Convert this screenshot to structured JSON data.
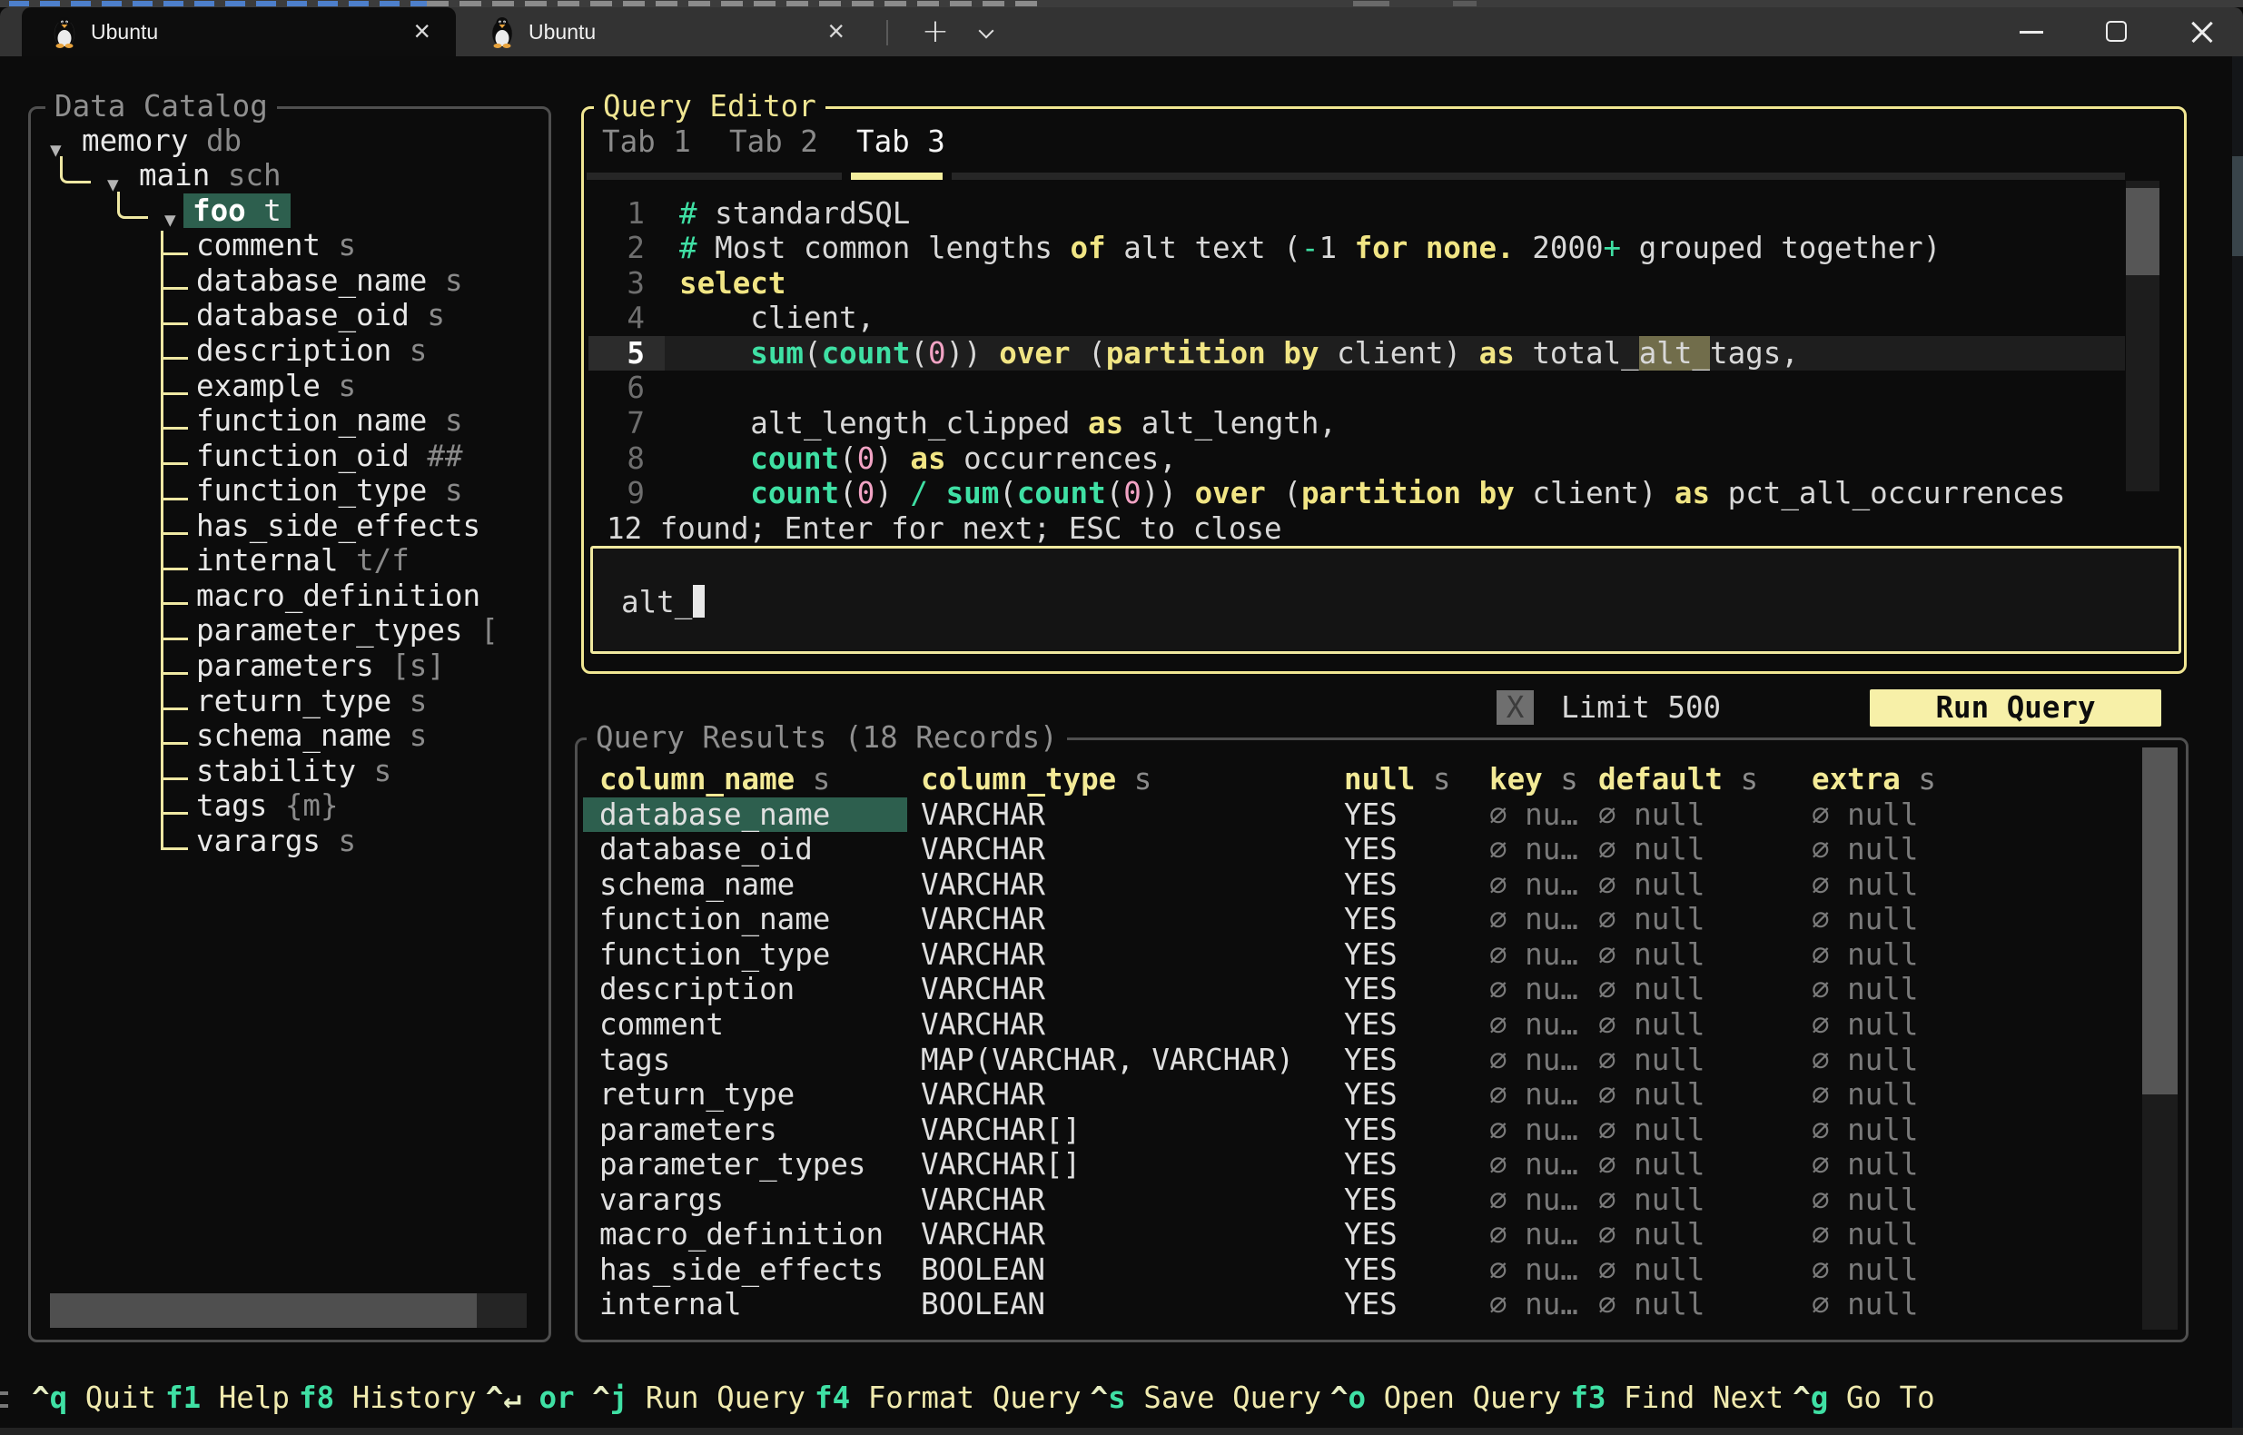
{
  "window": {
    "tabs": [
      {
        "label": "Ubuntu"
      },
      {
        "label": "Ubuntu"
      }
    ],
    "new_tab": "+",
    "close_glyph": "×"
  },
  "catalog": {
    "title": "Data Catalog",
    "items": [
      {
        "name": "memory",
        "type": "db",
        "level": 0,
        "arrow": true
      },
      {
        "name": "main",
        "type": "sch",
        "level": 1,
        "arrow": true
      },
      {
        "name": "foo",
        "type": "t",
        "level": 2,
        "arrow": true,
        "selected": true
      },
      {
        "name": "comment",
        "type": "s",
        "level": 3
      },
      {
        "name": "database_name",
        "type": "s",
        "level": 3
      },
      {
        "name": "database_oid",
        "type": "s",
        "level": 3
      },
      {
        "name": "description",
        "type": "s",
        "level": 3
      },
      {
        "name": "example",
        "type": "s",
        "level": 3
      },
      {
        "name": "function_name",
        "type": "s",
        "level": 3
      },
      {
        "name": "function_oid",
        "type": "##",
        "level": 3
      },
      {
        "name": "function_type",
        "type": "s",
        "level": 3
      },
      {
        "name": "has_side_effects",
        "type": "",
        "level": 3
      },
      {
        "name": "internal",
        "type": "t/f",
        "level": 3
      },
      {
        "name": "macro_definition",
        "type": "",
        "level": 3
      },
      {
        "name": "parameter_types",
        "type": "[",
        "level": 3
      },
      {
        "name": "parameters",
        "type": "[s]",
        "level": 3
      },
      {
        "name": "return_type",
        "type": "s",
        "level": 3
      },
      {
        "name": "schema_name",
        "type": "s",
        "level": 3
      },
      {
        "name": "stability",
        "type": "s",
        "level": 3
      },
      {
        "name": "tags",
        "type": "{m}",
        "level": 3
      },
      {
        "name": "varargs",
        "type": "s",
        "level": 3
      }
    ]
  },
  "editor": {
    "title": "Query Editor",
    "tabs": [
      "Tab 1",
      "Tab 2",
      "Tab 3"
    ],
    "active_tab": 2,
    "lines": [
      {
        "n": "1",
        "segs": [
          [
            "#",
            "o"
          ],
          [
            " standardSQL",
            "p"
          ]
        ]
      },
      {
        "n": "2",
        "segs": [
          [
            "#",
            "o"
          ],
          [
            " Most common lengths ",
            "p"
          ],
          [
            "of",
            "k"
          ],
          [
            " alt text (",
            "p"
          ],
          [
            "-",
            "o"
          ],
          [
            "1 ",
            "p"
          ],
          [
            "for none.",
            "k"
          ],
          [
            " 2000",
            "p"
          ],
          [
            "+",
            "o"
          ],
          [
            " grouped together)",
            "p"
          ]
        ]
      },
      {
        "n": "3",
        "segs": [
          [
            "select",
            "k"
          ]
        ]
      },
      {
        "n": "4",
        "segs": [
          [
            "    client,",
            "p"
          ]
        ]
      },
      {
        "n": "5",
        "current": true,
        "segs": [
          [
            "    ",
            "p"
          ],
          [
            "sum",
            "f"
          ],
          [
            "(",
            "p"
          ],
          [
            "count",
            "f"
          ],
          [
            "(",
            "p"
          ],
          [
            "0",
            "n"
          ],
          [
            ")) ",
            "p"
          ],
          [
            "over",
            "k"
          ],
          [
            " (",
            "p"
          ],
          [
            "partition",
            "k"
          ],
          [
            " ",
            "p"
          ],
          [
            "by",
            "k"
          ],
          [
            " client) ",
            "p"
          ],
          [
            "as",
            "k"
          ],
          [
            " total_",
            "p"
          ],
          [
            "alt_",
            "m"
          ],
          [
            "tags,",
            "p"
          ]
        ]
      },
      {
        "n": "6",
        "segs": []
      },
      {
        "n": "7",
        "segs": [
          [
            "    alt_length_clipped ",
            "p"
          ],
          [
            "as",
            "k"
          ],
          [
            " alt_length,",
            "p"
          ]
        ]
      },
      {
        "n": "8",
        "segs": [
          [
            "    ",
            "p"
          ],
          [
            "count",
            "f"
          ],
          [
            "(",
            "p"
          ],
          [
            "0",
            "n"
          ],
          [
            ") ",
            "p"
          ],
          [
            "as",
            "k"
          ],
          [
            " occurrences,",
            "p"
          ]
        ]
      },
      {
        "n": "9",
        "segs": [
          [
            "    ",
            "p"
          ],
          [
            "count",
            "f"
          ],
          [
            "(",
            "p"
          ],
          [
            "0",
            "n"
          ],
          [
            ") ",
            "p"
          ],
          [
            "/",
            "o"
          ],
          [
            " ",
            "p"
          ],
          [
            "sum",
            "f"
          ],
          [
            "(",
            "p"
          ],
          [
            "count",
            "f"
          ],
          [
            "(",
            "p"
          ],
          [
            "0",
            "n"
          ],
          [
            ")) ",
            "p"
          ],
          [
            "over",
            "k"
          ],
          [
            " (",
            "p"
          ],
          [
            "partition",
            "k"
          ],
          [
            " ",
            "p"
          ],
          [
            "by",
            "k"
          ],
          [
            " client) ",
            "p"
          ],
          [
            "as",
            "k"
          ],
          [
            " pct_all_occurrences",
            "p"
          ]
        ]
      }
    ],
    "search_status": "12 found; Enter for next; ESC to close",
    "search_value": "alt_"
  },
  "limit": {
    "checkbox": "X",
    "label": "Limit 500"
  },
  "run_button": "Run Query",
  "results": {
    "title": "Query Results (18 Records)",
    "headers": [
      {
        "label": "column_name",
        "hint": "s"
      },
      {
        "label": "column_type",
        "hint": "s"
      },
      {
        "label": "null",
        "hint": "s"
      },
      {
        "label": "key",
        "hint": "s"
      },
      {
        "label": "default",
        "hint": "s"
      },
      {
        "label": "extra",
        "hint": "s"
      }
    ],
    "selected_row": 0,
    "rows": [
      [
        "database_name",
        "VARCHAR",
        "YES",
        "∅ nu…",
        "∅ null",
        "∅ null"
      ],
      [
        "database_oid",
        "VARCHAR",
        "YES",
        "∅ nu…",
        "∅ null",
        "∅ null"
      ],
      [
        "schema_name",
        "VARCHAR",
        "YES",
        "∅ nu…",
        "∅ null",
        "∅ null"
      ],
      [
        "function_name",
        "VARCHAR",
        "YES",
        "∅ nu…",
        "∅ null",
        "∅ null"
      ],
      [
        "function_type",
        "VARCHAR",
        "YES",
        "∅ nu…",
        "∅ null",
        "∅ null"
      ],
      [
        "description",
        "VARCHAR",
        "YES",
        "∅ nu…",
        "∅ null",
        "∅ null"
      ],
      [
        "comment",
        "VARCHAR",
        "YES",
        "∅ nu…",
        "∅ null",
        "∅ null"
      ],
      [
        "tags",
        "MAP(VARCHAR, VARCHAR)",
        "YES",
        "∅ nu…",
        "∅ null",
        "∅ null"
      ],
      [
        "return_type",
        "VARCHAR",
        "YES",
        "∅ nu…",
        "∅ null",
        "∅ null"
      ],
      [
        "parameters",
        "VARCHAR[]",
        "YES",
        "∅ nu…",
        "∅ null",
        "∅ null"
      ],
      [
        "parameter_types",
        "VARCHAR[]",
        "YES",
        "∅ nu…",
        "∅ null",
        "∅ null"
      ],
      [
        "varargs",
        "VARCHAR",
        "YES",
        "∅ nu…",
        "∅ null",
        "∅ null"
      ],
      [
        "macro_definition",
        "VARCHAR",
        "YES",
        "∅ nu…",
        "∅ null",
        "∅ null"
      ],
      [
        "has_side_effects",
        "BOOLEAN",
        "YES",
        "∅ nu…",
        "∅ null",
        "∅ null"
      ],
      [
        "internal",
        "BOOLEAN",
        "YES",
        "∅ nu…",
        "∅ null",
        "∅ null"
      ]
    ]
  },
  "footer": {
    "items": [
      {
        "key": "^q",
        "label": "Quit"
      },
      {
        "key": "f1",
        "label": "Help"
      },
      {
        "key": "f8",
        "label": "History"
      },
      {
        "key": "^↵ or ^j",
        "label": "Run Query"
      },
      {
        "key": "f4",
        "label": "Format Query"
      },
      {
        "key": "^s",
        "label": "Save Query"
      },
      {
        "key": "^o",
        "label": "Open Query"
      },
      {
        "key": "f3",
        "label": "Find Next"
      },
      {
        "key": "^g",
        "label": "Go To"
      }
    ]
  },
  "colors": {
    "accent_yellow": "#f0e692",
    "keyword": "#f1e584",
    "function_teal": "#3fe0a4",
    "number_pink": "#f2a3c4",
    "selection_green": "#2d5f4e",
    "match_olive": "#716d4b",
    "run_button_bg": "#f7f0a8"
  }
}
